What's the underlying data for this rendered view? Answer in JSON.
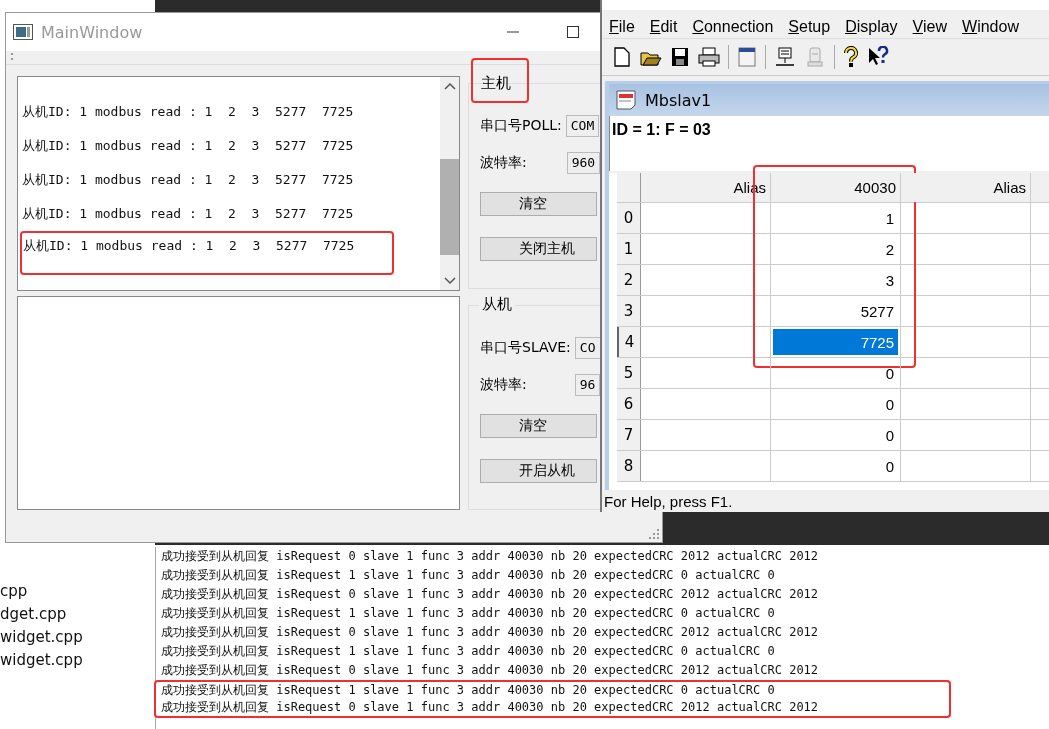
{
  "file_list": [
    "cpp",
    "dget.cpp",
    "widget.cpp",
    "widget.cpp"
  ],
  "main_window": {
    "title": "MainWindow",
    "master_log": [
      {
        "text": "从机ID: 1 modbus read : 1  2  3  5277  7725",
        "highlighted": false
      },
      {
        "text": "从机ID: 1 modbus read : 1  2  3  5277  7725",
        "highlighted": false
      },
      {
        "text": "从机ID: 1 modbus read : 1  2  3  5277  7725",
        "highlighted": false
      },
      {
        "text": "从机ID: 1 modbus read : 1  2  3  5277  7725",
        "highlighted": false
      },
      {
        "text": "从机ID: 1 modbus read : 1  2  3  5277  7725",
        "highlighted": true
      }
    ],
    "groups": [
      {
        "title": "主机",
        "highlighted": true,
        "port_label": "串口号POLL:",
        "port_value": "COM",
        "baud_label": "波特率:",
        "baud_value": "960",
        "buttons": [
          "清空",
          "关闭主机"
        ]
      },
      {
        "title": "从机",
        "highlighted": false,
        "port_label": "串口号SLAVE:",
        "port_value": "CO",
        "baud_label": "波特率:",
        "baud_value": "96",
        "buttons": [
          "清空",
          "开启从机"
        ]
      }
    ]
  },
  "modbus_window": {
    "menu": [
      "File",
      "Edit",
      "Connection",
      "Setup",
      "Display",
      "View",
      "Window"
    ],
    "child": {
      "title": "Mbslav1",
      "info": "ID = 1: F = 03",
      "columns": [
        {
          "label": "Alias",
          "highlighted": false
        },
        {
          "label": "40030",
          "highlighted": true
        },
        {
          "label": "Alias",
          "highlighted": false
        }
      ],
      "rows": [
        {
          "index": "0",
          "value": "1",
          "selected": false,
          "highlighted": true
        },
        {
          "index": "1",
          "value": "2",
          "selected": false,
          "highlighted": true
        },
        {
          "index": "2",
          "value": "3",
          "selected": false,
          "highlighted": true
        },
        {
          "index": "3",
          "value": "5277",
          "selected": false,
          "highlighted": true
        },
        {
          "index": "4",
          "value": "7725",
          "selected": true,
          "highlighted": true
        },
        {
          "index": "5",
          "value": "0",
          "selected": false,
          "highlighted": false
        },
        {
          "index": "6",
          "value": "0",
          "selected": false,
          "highlighted": false
        },
        {
          "index": "7",
          "value": "0",
          "selected": false,
          "highlighted": false
        },
        {
          "index": "8",
          "value": "0",
          "selected": false,
          "highlighted": false
        }
      ]
    },
    "status_bar": "For Help, press F1."
  },
  "console": {
    "lines": [
      {
        "text": "成功接受到从机回复 isRequest 0 slave 1 func 3 addr 40030 nb 20 expectedCRC 2012 actualCRC 2012",
        "highlighted": false
      },
      {
        "text": "成功接受到从机回复 isRequest 1 slave 1 func 3 addr 40030 nb 20 expectedCRC 0 actualCRC 0",
        "highlighted": false
      },
      {
        "text": "成功接受到从机回复 isRequest 0 slave 1 func 3 addr 40030 nb 20 expectedCRC 2012 actualCRC 2012",
        "highlighted": false
      },
      {
        "text": "成功接受到从机回复 isRequest 1 slave 1 func 3 addr 40030 nb 20 expectedCRC 0 actualCRC 0",
        "highlighted": false
      },
      {
        "text": "成功接受到从机回复 isRequest 0 slave 1 func 3 addr 40030 nb 20 expectedCRC 2012 actualCRC 2012",
        "highlighted": false
      },
      {
        "text": "成功接受到从机回复 isRequest 1 slave 1 func 3 addr 40030 nb 20 expectedCRC 0 actualCRC 0",
        "highlighted": false
      },
      {
        "text": "成功接受到从机回复 isRequest 0 slave 1 func 3 addr 40030 nb 20 expectedCRC 2012 actualCRC 2012",
        "highlighted": false
      },
      {
        "text": "成功接受到从机回复 isRequest 1 slave 1 func 3 addr 40030 nb 20 expectedCRC 0 actualCRC 0",
        "highlighted": true
      },
      {
        "text": "成功接受到从机回复 isRequest 0 slave 1 func 3 addr 40030 nb 20 expectedCRC 2012 actualCRC 2012",
        "highlighted": true
      }
    ]
  }
}
